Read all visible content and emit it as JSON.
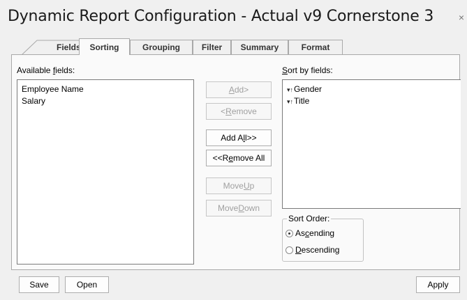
{
  "window": {
    "title": "Dynamic Report Configuration - Actual v9 Cornerstone 3",
    "close_glyph": "×"
  },
  "tabs": [
    {
      "label": "Fields",
      "active": false
    },
    {
      "label": "Sorting",
      "active": true
    },
    {
      "label": "Grouping",
      "active": false
    },
    {
      "label": "Filter",
      "active": false
    },
    {
      "label": "Summary",
      "active": false
    },
    {
      "label": "Format",
      "active": false
    }
  ],
  "available_fields": {
    "label_pre": "Available ",
    "label_accel": "f",
    "label_post": "ields:",
    "items": [
      "Employee Name",
      "Salary"
    ]
  },
  "sort_by_fields": {
    "label_accel": "S",
    "label_post": "ort by fields:",
    "items": [
      {
        "name": "Gender",
        "direction_icon": "sort-ascending-icon",
        "glyph": "▾↑"
      },
      {
        "name": "Title",
        "direction_icon": "sort-ascending-icon",
        "glyph": "▾↑"
      }
    ]
  },
  "buttons": {
    "add": {
      "pre": "",
      "accel": "A",
      "post": "dd>",
      "enabled": false
    },
    "remove": {
      "pre": "<",
      "accel": "R",
      "post": "emove",
      "enabled": false
    },
    "add_all": {
      "pre": "Add A",
      "accel": "l",
      "post": "l>>",
      "enabled": true
    },
    "remove_all": {
      "pre": "<<R",
      "accel": "e",
      "post": "move All",
      "enabled": true
    },
    "move_up": {
      "pre": "Move ",
      "accel": "U",
      "post": "p",
      "enabled": false
    },
    "move_down": {
      "pre": "Move ",
      "accel": "D",
      "post": "own",
      "enabled": false
    }
  },
  "sort_order": {
    "title": "Sort Order:",
    "ascending": {
      "pre": "As",
      "accel": "c",
      "post": "ending",
      "checked": true
    },
    "descending": {
      "pre": "",
      "accel": "D",
      "post": "escending",
      "checked": false
    }
  },
  "footer": {
    "save_label": "Save",
    "open_label": "Open",
    "apply_label": "Apply"
  },
  "colors": {
    "window_bg": "#f0f0f0",
    "panel_bg": "#fafafa",
    "disabled_text": "#a0a0a0"
  }
}
